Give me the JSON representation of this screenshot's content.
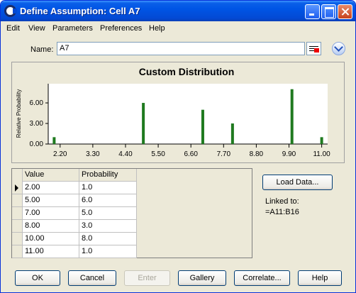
{
  "window": {
    "title": "Define Assumption: Cell A7"
  },
  "menu": [
    "Edit",
    "View",
    "Parameters",
    "Preferences",
    "Help"
  ],
  "name_field": {
    "label": "Name:",
    "value": "A7"
  },
  "chart_data": {
    "type": "bar",
    "title": "Custom Distribution",
    "ylabel": "Relative Probability",
    "xlabel": "",
    "x": [
      2.0,
      5.0,
      7.0,
      8.0,
      10.0,
      11.0
    ],
    "values": [
      1.0,
      6.0,
      5.0,
      3.0,
      8.0,
      1.0
    ],
    "xlim": [
      1.8,
      11.2
    ],
    "ylim": [
      0,
      8.8
    ],
    "x_ticks": [
      "2.20",
      "3.30",
      "4.40",
      "5.50",
      "6.60",
      "7.70",
      "8.80",
      "9.90",
      "11.00"
    ],
    "y_ticks": [
      "0.00",
      "3.00",
      "6.00"
    ],
    "bar_color": "#1f7a1f",
    "grid": false
  },
  "table": {
    "columns": [
      "Value",
      "Probability"
    ],
    "rows": [
      [
        "2.00",
        "1.0"
      ],
      [
        "5.00",
        "6.0"
      ],
      [
        "7.00",
        "5.0"
      ],
      [
        "8.00",
        "3.0"
      ],
      [
        "10.00",
        "8.0"
      ],
      [
        "11.00",
        "1.0"
      ]
    ]
  },
  "side": {
    "load_button": "Load Data...",
    "linked_label": "Linked to:",
    "linked_value": "=A11:B16"
  },
  "buttons": {
    "ok": "OK",
    "cancel": "Cancel",
    "enter": "Enter",
    "gallery": "Gallery",
    "correlate": "Correlate...",
    "help": "Help"
  }
}
